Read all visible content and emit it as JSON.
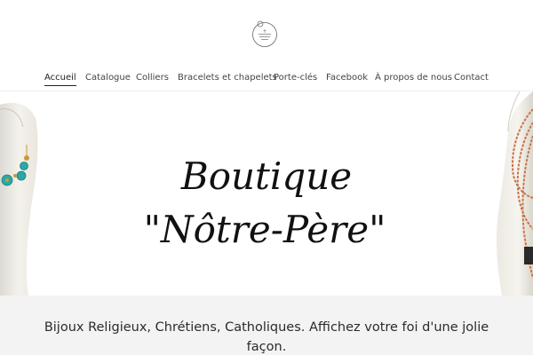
{
  "site": {
    "logo_alt": "Boutique Nôtre Père logo"
  },
  "nav": {
    "items": [
      {
        "label": "Accueil"
      },
      {
        "label": "Catalogue"
      },
      {
        "label": "Colliers"
      },
      {
        "label": "Bracelets et chapelets"
      },
      {
        "label": "Porte-clés"
      },
      {
        "label": "Facebook"
      },
      {
        "label": "À propos de nous"
      },
      {
        "label": "Contact"
      }
    ]
  },
  "hero": {
    "title_line1": "Boutique",
    "title_line2": "\"Nôtre-Père\""
  },
  "tagline": "Bijoux Religieux, Chrétiens, Catholiques. Affichez votre foi d'une jolie façon.",
  "colors": {
    "accent": "#222222",
    "band": "#f3f3f3",
    "turquoise": "#2aa7a6",
    "gold": "#c9983a",
    "copper": "#c8744a"
  }
}
